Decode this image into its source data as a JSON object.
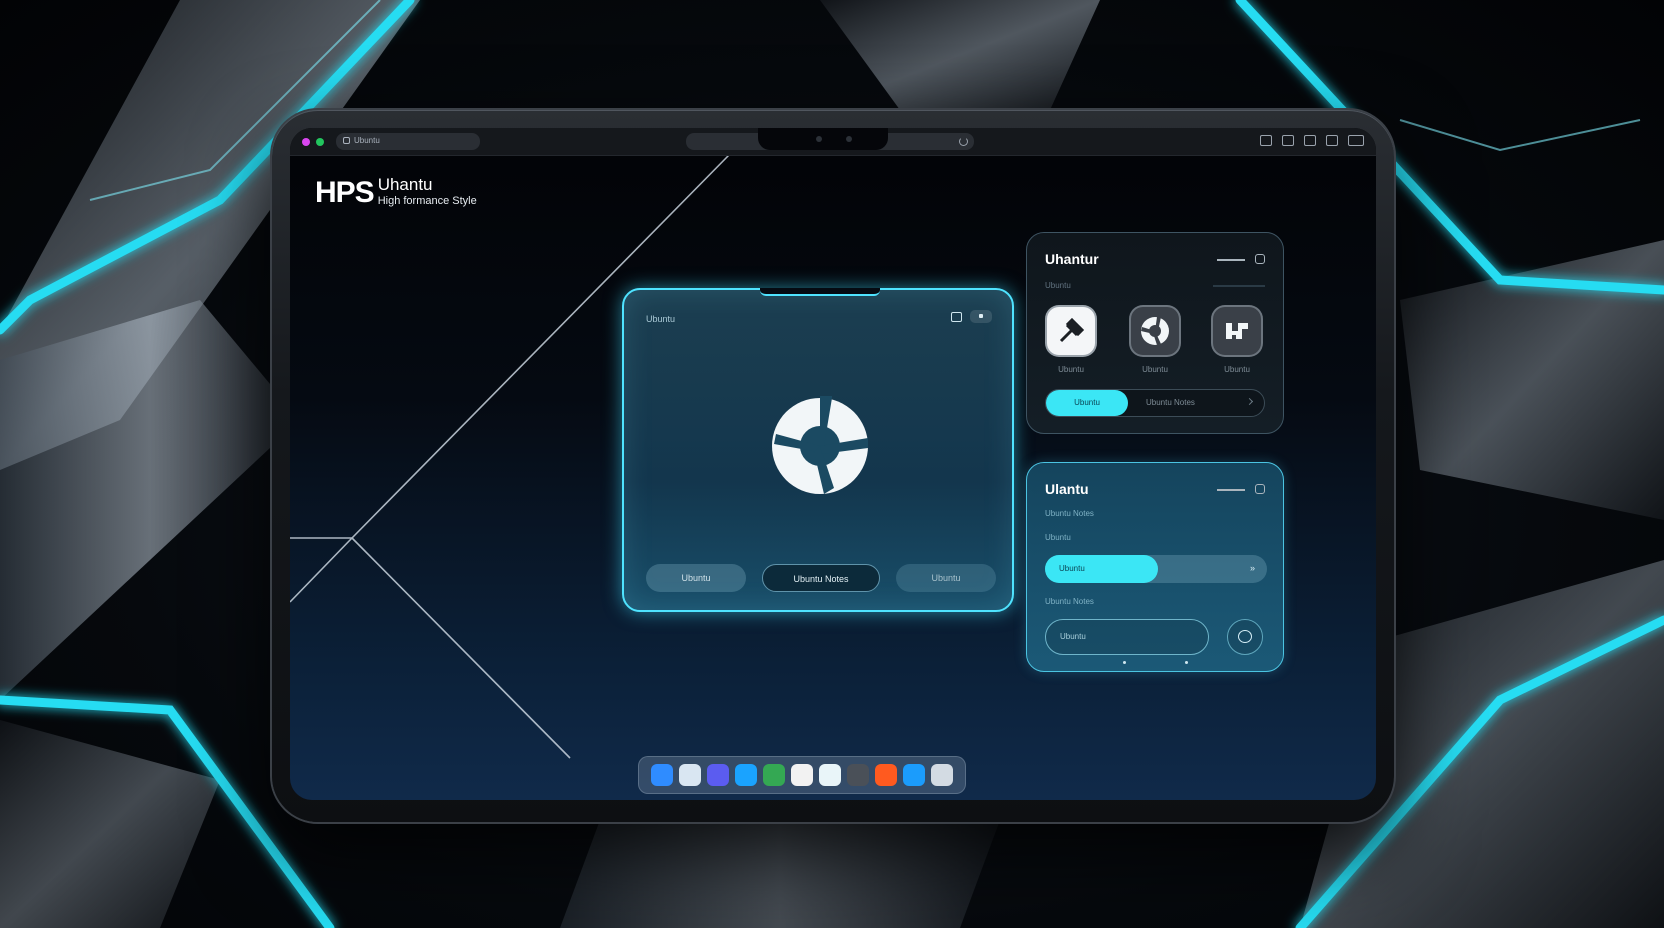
{
  "window": {
    "url_text": "Ubuntu",
    "traffic_colors": [
      "#d946ef",
      "#22c55e"
    ]
  },
  "brand": {
    "mark": "HPS",
    "name": "Uhantu",
    "tagline": "High formance Style"
  },
  "center_window": {
    "title": "Ubuntu",
    "logo": "ubuntu-circle-logo",
    "buttons": [
      "Ubuntu",
      "Ubuntu Notes",
      "Ubuntu"
    ]
  },
  "panel_a": {
    "title": "Uhantur",
    "subtitle": "Ubuntu",
    "apps": [
      {
        "icon": "pin-icon",
        "label": "Ubuntu"
      },
      {
        "icon": "ubuntu-logo-icon",
        "label": "Ubuntu"
      },
      {
        "icon": "grid-blocks-icon",
        "label": "Ubuntu"
      }
    ],
    "toggle_on": "Ubuntu",
    "toggle_off": "Ubuntu Notes",
    "accent": "#3be6f5"
  },
  "panel_b": {
    "title": "Ulantu",
    "subtitle_1": "Ubuntu Notes",
    "subtitle_2": "Ubuntu",
    "slider_label": "Ubuntu",
    "slider_value": 0.51,
    "slider_end": "»",
    "subtitle_3": "Ubuntu Notes",
    "input_placeholder": "Ubuntu",
    "accent": "#3be6f5"
  },
  "dock": {
    "apps": [
      {
        "icon": "finder-icon",
        "color": "#2f8cff"
      },
      {
        "icon": "files-icon",
        "color": "#d9e6f2"
      },
      {
        "icon": "feather-icon",
        "color": "#5b5cf0"
      },
      {
        "icon": "safari-icon",
        "color": "#1aa3ff"
      },
      {
        "icon": "chrome-icon",
        "color": "#34a853"
      },
      {
        "icon": "calendar-icon",
        "color": "#f2f2f2"
      },
      {
        "icon": "maps-icon",
        "color": "#e9f5f9"
      },
      {
        "icon": "pen-icon",
        "color": "#4a5058"
      },
      {
        "icon": "ubuntu-orange-icon",
        "color": "#ff5a1f"
      },
      {
        "icon": "terminal-icon",
        "color": "#1b9cfc"
      },
      {
        "icon": "stats-icon",
        "color": "#d3dbe3"
      }
    ]
  }
}
